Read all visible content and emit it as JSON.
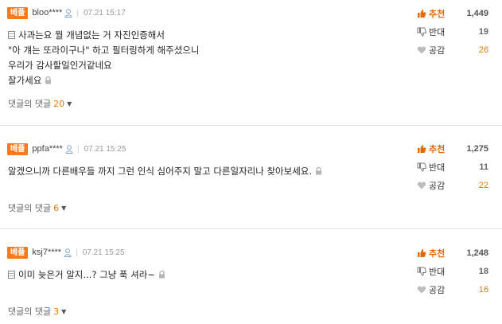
{
  "comments": [
    {
      "badge": "베플",
      "username": "bloo****",
      "date": "07.21 15:17",
      "lines": [
        "사과는요 뭘 개념없는 거 자진인증해서",
        "\"아 걔는 또라이구나\" 하고 필터링하게 해주셨으니",
        "우리가 감사할일인거같네요",
        "잘가세요"
      ],
      "replies_label": "댓글의 댓글",
      "replies_count": "20",
      "recommend_label": "추천",
      "recommend_count": "1,449",
      "oppose_label": "반대",
      "oppose_count": "19",
      "sympathy_label": "공감",
      "sympathy_count": "26"
    },
    {
      "badge": "베플",
      "username": "ppfa****",
      "date": "07.21 15:25",
      "lines": [
        "알겠으니까 다른배우들 까지 그런 인식 심어주지 말고 다른일자리나 찾아보세요."
      ],
      "replies_label": "댓글의 댓글",
      "replies_count": "6",
      "recommend_label": "추천",
      "recommend_count": "1,275",
      "oppose_label": "반대",
      "oppose_count": "11",
      "sympathy_label": "공감",
      "sympathy_count": "22"
    },
    {
      "badge": "베플",
      "username": "ksj7****",
      "date": "07.21 15:25",
      "lines": [
        "이미 늦은거 알지...? 그냥 푹 셔라~"
      ],
      "replies_label": "댓글의 댓글",
      "replies_count": "3",
      "recommend_label": "추천",
      "recommend_count": "1,248",
      "oppose_label": "반대",
      "oppose_count": "18",
      "sympathy_label": "공감",
      "sympathy_count": "16"
    }
  ],
  "icons": {
    "user": "user-icon",
    "memo": "memo-icon",
    "lock": "lock-icon",
    "recommend": "thumbs-up-icon",
    "oppose": "thumbs-down-icon",
    "sympathy": "heart-icon"
  },
  "colors": {
    "badge": "#f47b20",
    "accent": "#f07800",
    "recommend": "#e36a00"
  }
}
